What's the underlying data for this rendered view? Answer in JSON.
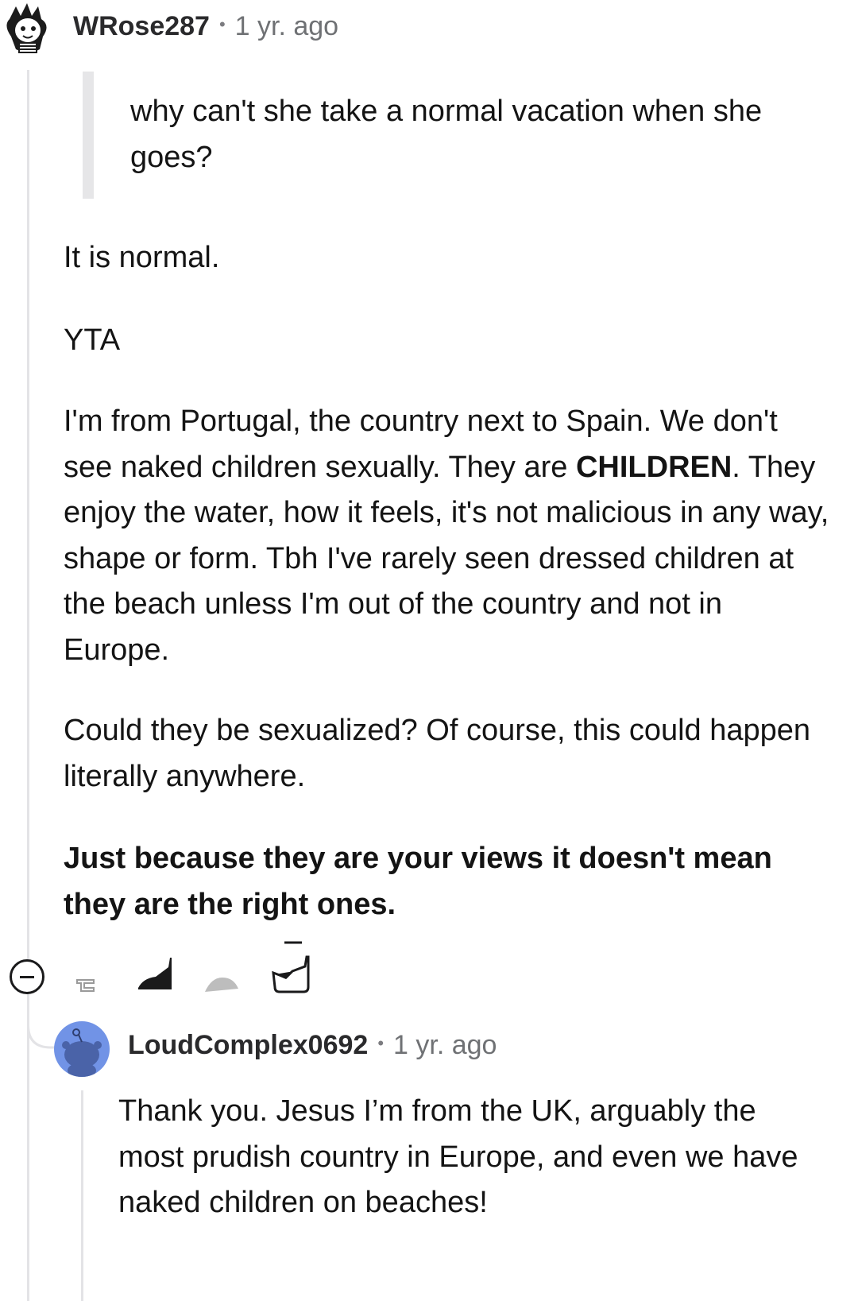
{
  "comment1": {
    "username": "WRose287",
    "separator": "•",
    "time": "1 yr. ago",
    "quote": "why can't she take a normal vacation when she goes?",
    "para1": "It is normal.",
    "para2": "YTA",
    "para3_lead": "I'm from Portugal, the country next to Spain. We don't see naked children sexually. They are ",
    "para3_bold": "CHILDREN",
    "para3_tail": ". They enjoy the water, how it feels, it's not malicious in any way, shape or form. Tbh I've rarely seen dressed children at the beach unless I'm out of the country and not in Europe.",
    "para4": "Could they be sexualized? Of course, this could happen literally anywhere.",
    "para5": "Just because they are your views it doesn't mean they are the right ones."
  },
  "actions": {
    "icons": [
      "collapse-icon",
      "upvote-icon",
      "downvote-icon",
      "reply-icon",
      "share-icon"
    ]
  },
  "comment2": {
    "username": "LoudComplex0692",
    "separator": "•",
    "time": "1 yr. ago",
    "body": "Thank you. Jesus I’m from the UK, arguably the most prudish country in Europe, and even we have naked children on beaches!"
  },
  "colors": {
    "thread_line": "#e3e3e6",
    "avatar2_bg": "#7193e6"
  }
}
